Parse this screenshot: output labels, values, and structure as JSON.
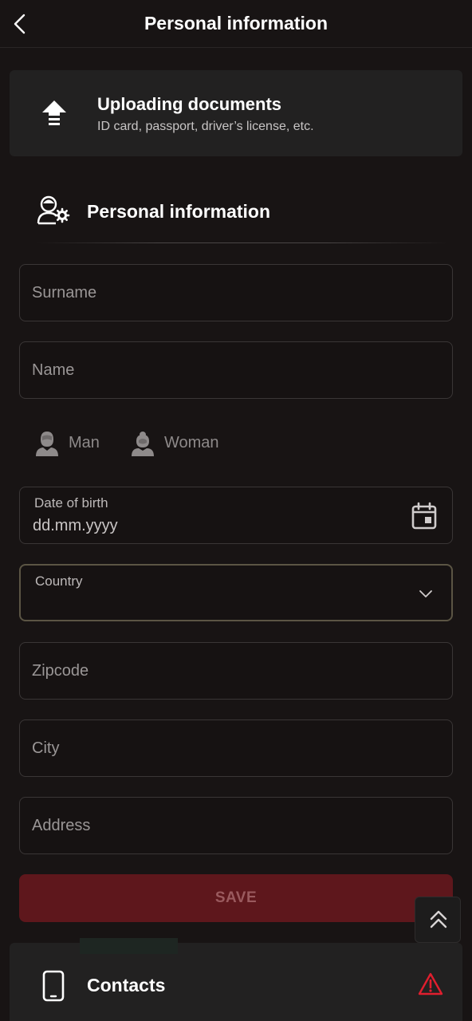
{
  "header": {
    "title": "Personal information"
  },
  "upload": {
    "title": "Uploading documents",
    "subtitle": "ID card, passport, driver’s license, etc."
  },
  "section": {
    "title": "Personal information"
  },
  "form": {
    "surname": {
      "placeholder": "Surname"
    },
    "name": {
      "placeholder": "Name"
    },
    "gender": {
      "man": "Man",
      "woman": "Woman"
    },
    "dob": {
      "label": "Date of birth",
      "placeholder": "dd.mm.yyyy"
    },
    "country": {
      "label": "Country"
    },
    "zipcode": {
      "placeholder": "Zipcode"
    },
    "city": {
      "placeholder": "City"
    },
    "address": {
      "placeholder": "Address"
    },
    "save_label": "SAVE"
  },
  "contacts": {
    "label": "Contacts"
  },
  "icons": {
    "back": "chevron-left-icon",
    "upload": "upload-arrow-icon",
    "user_settings": "user-gear-icon",
    "man": "man-avatar-icon",
    "woman": "woman-avatar-icon",
    "calendar": "calendar-icon",
    "dropdown": "chevron-down-icon",
    "scroll_top": "double-chevron-up-icon",
    "phone": "smartphone-icon",
    "warning": "warning-triangle-icon"
  },
  "colors": {
    "background": "#181414",
    "card": "#222121",
    "save_button": "#5e171c",
    "warning": "#e01e2e",
    "country_border": "#5b5544"
  }
}
